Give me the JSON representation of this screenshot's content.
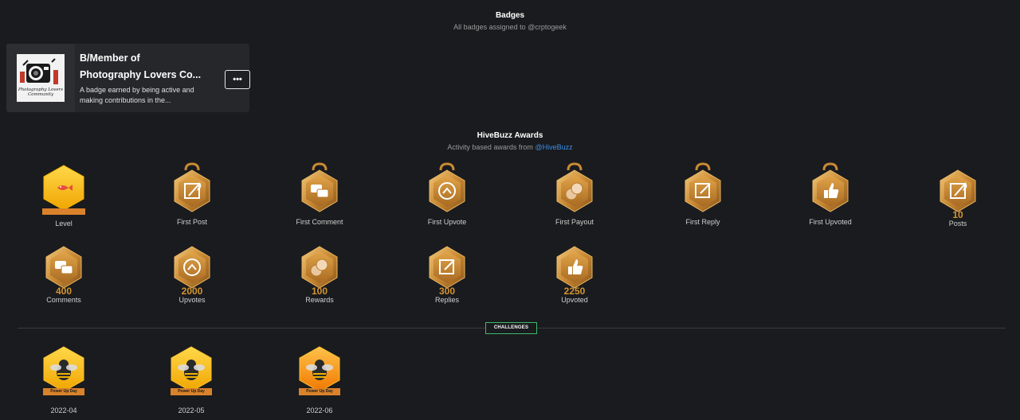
{
  "badges_section": {
    "title": "Badges",
    "subtitle": "All badges assigned to @crptogeek"
  },
  "badge": {
    "name_line1": "B/Member of",
    "name_line2": "Photography Lovers Co...",
    "description": "A badge earned by being active and making contributions in the...",
    "logo_text_line1": "Photography Lovers",
    "logo_text_line2": "Community",
    "more_label": "•••"
  },
  "hivebuzz_section": {
    "title": "HiveBuzz Awards",
    "subtitle_prefix": "Activity based awards from ",
    "subtitle_link": "@HiveBuzz"
  },
  "awards_row1": [
    {
      "label": "Level",
      "icon": "fish-icon",
      "count": ""
    },
    {
      "label": "First Post",
      "icon": "quill-icon",
      "count": ""
    },
    {
      "label": "First Comment",
      "icon": "chat-bubbles-icon",
      "count": ""
    },
    {
      "label": "First Upvote",
      "icon": "upvote-icon",
      "count": ""
    },
    {
      "label": "First Payout",
      "icon": "coins-icon",
      "count": ""
    },
    {
      "label": "First Reply",
      "icon": "edit-icon",
      "count": ""
    },
    {
      "label": "First Upvoted",
      "icon": "thumbs-up-icon",
      "count": ""
    },
    {
      "label": "Posts",
      "icon": "quill-icon",
      "count": "10"
    }
  ],
  "awards_row2": [
    {
      "label": "Comments",
      "icon": "chat-bubbles-icon",
      "count": "400"
    },
    {
      "label": "Upvotes",
      "icon": "upvote-icon",
      "count": "2000"
    },
    {
      "label": "Rewards",
      "icon": "coins-icon",
      "count": "100"
    },
    {
      "label": "Replies",
      "icon": "edit-icon",
      "count": "300"
    },
    {
      "label": "Upvoted",
      "icon": "thumbs-up-icon",
      "count": "2250"
    }
  ],
  "challenges_tag": "CHALLENGES",
  "challenges": [
    {
      "label": "2022-04",
      "ribbon": "Power Up Day",
      "icon": "bee-icon"
    },
    {
      "label": "2022-05",
      "ribbon": "Power Up Day",
      "icon": "bee-icon"
    },
    {
      "label": "2022-06",
      "ribbon": "Power Up Day",
      "icon": "bee-icon"
    }
  ],
  "colors": {
    "background": "#1a1b1e",
    "card": "#26272b",
    "gold": "#d4952e",
    "link": "#3b8ee8",
    "challenge_border": "#3fb86a"
  }
}
